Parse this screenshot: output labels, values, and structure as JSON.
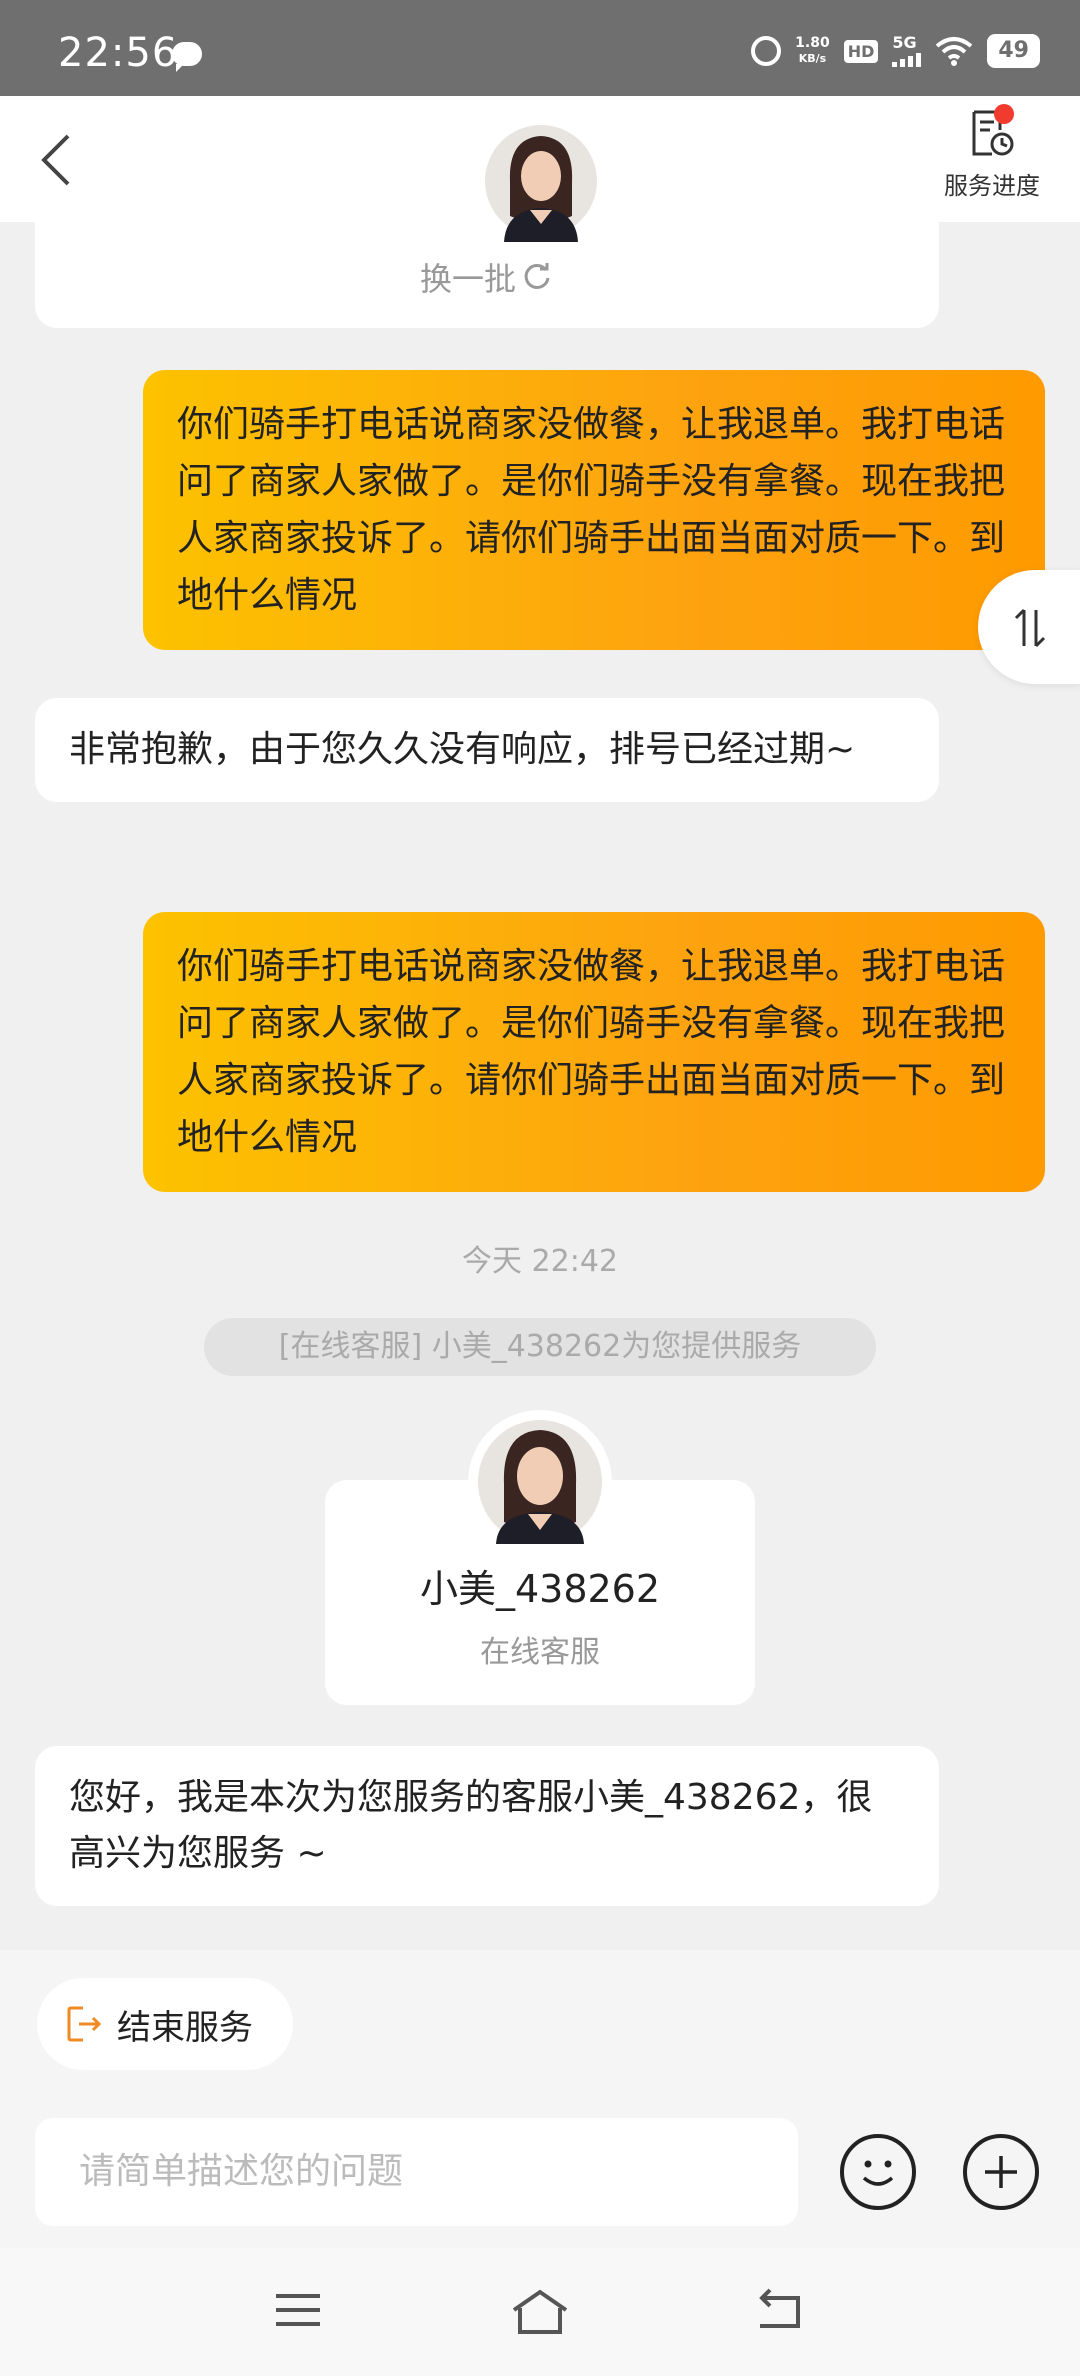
{
  "status_bar": {
    "time": "22:56",
    "net_speed_value": "1.80",
    "net_speed_unit": "KB/s",
    "hd": "HD",
    "network": "5G",
    "battery": "49"
  },
  "header": {
    "service_progress_label": "服务进度",
    "has_notification": true
  },
  "recommend": {
    "refresh_label": "换一批"
  },
  "messages": [
    {
      "from": "user",
      "text": "你们骑手打电话说商家没做餐，让我退单。我打电话问了商家人家做了。是你们骑手没有拿餐。现在我把人家商家投诉了。请你们骑手出面当面对质一下。到地什么情况"
    },
    {
      "from": "agent",
      "text": "非常抱歉，由于您久久没有响应，排号已经过期~"
    },
    {
      "from": "user",
      "text": "你们骑手打电话说商家没做餐，让我退单。我打电话问了商家人家做了。是你们骑手没有拿餐。现在我把人家商家投诉了。请你们骑手出面当面对质一下。到地什么情况"
    },
    {
      "from": "agent",
      "text": "您好，我是本次为您服务的客服小美_438262，很高兴为您服务 ~"
    }
  ],
  "timestamp": "今天 22:42",
  "system_notice": "[在线客服] 小美_438262为您提供服务",
  "agent_card": {
    "name": "小美_438262",
    "role": "在线客服"
  },
  "bottom": {
    "end_service_label": "结束服务",
    "input_placeholder": "请简单描述您的问题"
  },
  "colors": {
    "user_bubble_start": "#fdc200",
    "user_bubble_end": "#ff9a00",
    "end_icon": "#f08a24",
    "notification_dot": "#f23b2f"
  }
}
